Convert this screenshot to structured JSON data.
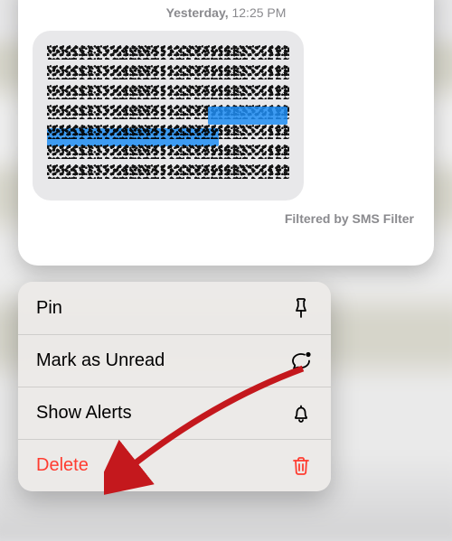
{
  "preview": {
    "timestamp_day": "Yesterday,",
    "timestamp_time": "12:25 PM",
    "filter_label": "Filtered by SMS Filter"
  },
  "menu": {
    "pin_label": "Pin",
    "mark_unread_label": "Mark as Unread",
    "show_alerts_label": "Show Alerts",
    "delete_label": "Delete"
  },
  "colors": {
    "destructive": "#ff3c30",
    "arrow": "#c4181d"
  }
}
